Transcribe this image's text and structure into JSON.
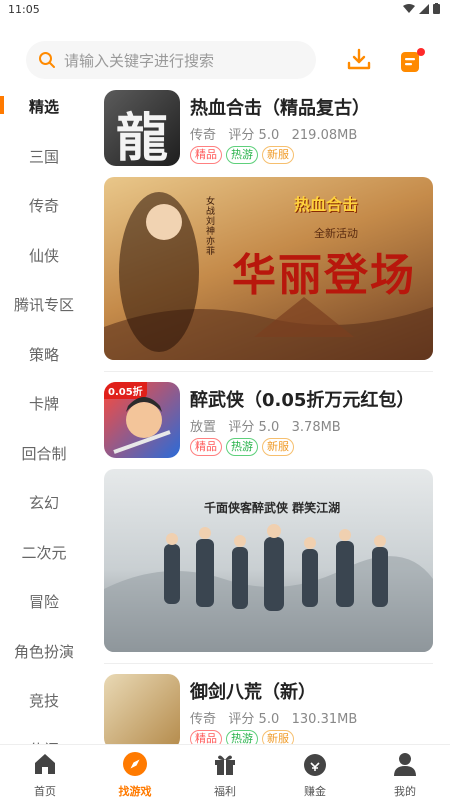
{
  "status": {
    "time": "11:05"
  },
  "search": {
    "placeholder": "请输入关键字进行搜索"
  },
  "sidebar": {
    "items": [
      {
        "label": "精选"
      },
      {
        "label": "三国"
      },
      {
        "label": "传奇"
      },
      {
        "label": "仙侠"
      },
      {
        "label": "腾讯专区"
      },
      {
        "label": "策略"
      },
      {
        "label": "卡牌"
      },
      {
        "label": "回合制"
      },
      {
        "label": "玄幻"
      },
      {
        "label": "二次元"
      },
      {
        "label": "冒险"
      },
      {
        "label": "角色扮演"
      },
      {
        "label": "竞技"
      },
      {
        "label": "休闲"
      }
    ],
    "active_index": 0
  },
  "games": [
    {
      "title": "热血合击（精品复古）",
      "category": "传奇",
      "rating": "评分 5.0",
      "size": "219.08MB",
      "tags": [
        "精品",
        "热游",
        "新服"
      ],
      "icon_text": "龍"
    },
    {
      "title": "醉武侠（0.05折万元红包）",
      "category": "放置",
      "rating": "评分 5.0",
      "size": "3.78MB",
      "tags": [
        "精品",
        "热游",
        "新服"
      ],
      "icon_text": "0.05折"
    },
    {
      "title": "御剑八荒（新）",
      "category": "传奇",
      "rating": "评分 5.0",
      "size": "130.31MB",
      "tags": [
        "精品",
        "热游",
        "新服"
      ]
    }
  ],
  "banners": [
    {
      "logo_text": "热血合击",
      "headline": "华丽登场",
      "sub": "全新活动",
      "side": "女战刘神亦菲"
    },
    {
      "headline": "千面侠客醉武侠 群笑江湖"
    }
  ],
  "tabbar": {
    "items": [
      {
        "label": "首页"
      },
      {
        "label": "找游戏"
      },
      {
        "label": "福利"
      },
      {
        "label": "赚金"
      },
      {
        "label": "我的"
      }
    ],
    "active_index": 1,
    "accent": "#ff7a00"
  }
}
